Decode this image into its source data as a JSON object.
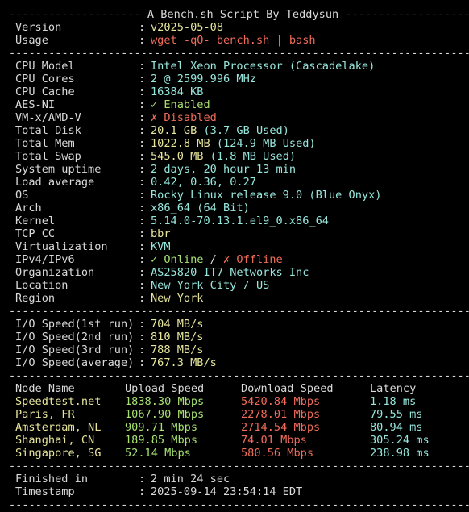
{
  "header_line": "-------------------- A Bench.sh Script By Teddysun -------------------",
  "separator": "----------------------------------------------------------------------",
  "sections": {
    "intro": [
      {
        "label": "Version",
        "value": "v2025-05-08",
        "color": "#e6e59b"
      },
      {
        "label": "Usage",
        "value": "wget -qO- bench.sh | bash",
        "color": "#f06b5a"
      }
    ],
    "system": [
      {
        "label": "CPU Model",
        "parts": [
          {
            "t": "Intel Xeon Processor (Cascadelake)",
            "c": "#96e6dc"
          }
        ]
      },
      {
        "label": "CPU Cores",
        "parts": [
          {
            "t": "2 @ 2599.996 MHz",
            "c": "#96e6dc"
          }
        ]
      },
      {
        "label": "CPU Cache",
        "parts": [
          {
            "t": "16384 KB",
            "c": "#96e6dc"
          }
        ]
      },
      {
        "label": "AES-NI",
        "parts": [
          {
            "t": "✓ Enabled",
            "c": "#a6e070"
          }
        ]
      },
      {
        "label": "VM-x/AMD-V",
        "parts": [
          {
            "t": "✗ Disabled",
            "c": "#f06b5a"
          }
        ]
      },
      {
        "label": "Total Disk",
        "parts": [
          {
            "t": "20.1 GB",
            "c": "#e6e59b"
          },
          {
            "t": " (3.7 GB Used)",
            "c": "#96e6dc"
          }
        ]
      },
      {
        "label": "Total Mem",
        "parts": [
          {
            "t": "1022.8 MB",
            "c": "#e6e59b"
          },
          {
            "t": " (124.9 MB Used)",
            "c": "#96e6dc"
          }
        ]
      },
      {
        "label": "Total Swap",
        "parts": [
          {
            "t": "545.0 MB",
            "c": "#e6e59b"
          },
          {
            "t": " (1.8 MB Used)",
            "c": "#96e6dc"
          }
        ]
      },
      {
        "label": "System uptime",
        "parts": [
          {
            "t": "2 days, 20 hour 13 min",
            "c": "#96e6dc"
          }
        ]
      },
      {
        "label": "Load average",
        "parts": [
          {
            "t": "0.42, 0.36, 0.27",
            "c": "#96e6dc"
          }
        ]
      },
      {
        "label": "OS",
        "parts": [
          {
            "t": "Rocky Linux release 9.0 (Blue Onyx)",
            "c": "#96e6dc"
          }
        ]
      },
      {
        "label": "Arch",
        "parts": [
          {
            "t": "x86_64 (64 Bit)",
            "c": "#96e6dc"
          }
        ]
      },
      {
        "label": "Kernel",
        "parts": [
          {
            "t": "5.14.0-70.13.1.el9_0.x86_64",
            "c": "#96e6dc"
          }
        ]
      },
      {
        "label": "TCP CC",
        "parts": [
          {
            "t": "bbr",
            "c": "#e6e59b"
          }
        ]
      },
      {
        "label": "Virtualization",
        "parts": [
          {
            "t": "KVM",
            "c": "#96e6dc"
          }
        ]
      },
      {
        "label": "IPv4/IPv6",
        "parts": [
          {
            "t": "✓ Online",
            "c": "#a6e070"
          },
          {
            "t": " / ",
            "c": "#d9d9d9"
          },
          {
            "t": "✗ Offline",
            "c": "#f06b5a"
          }
        ]
      },
      {
        "label": "Organization",
        "parts": [
          {
            "t": "AS25820 IT7 Networks Inc",
            "c": "#96e6dc"
          }
        ]
      },
      {
        "label": "Location",
        "parts": [
          {
            "t": "New York City / US",
            "c": "#96e6dc"
          }
        ]
      },
      {
        "label": "Region",
        "parts": [
          {
            "t": "New York",
            "c": "#e6e59b"
          }
        ]
      }
    ],
    "io": [
      {
        "label": "I/O Speed(1st run)",
        "value": "704 MB/s"
      },
      {
        "label": "I/O Speed(2nd run)",
        "value": "810 MB/s"
      },
      {
        "label": "I/O Speed(3rd run)",
        "value": "788 MB/s"
      },
      {
        "label": "I/O Speed(average)",
        "value": "767.3 MB/s"
      }
    ],
    "speed": {
      "headers": [
        "Node Name",
        "Upload Speed",
        "Download Speed",
        "Latency"
      ],
      "rows": [
        [
          "Speedtest.net",
          "1838.30 Mbps",
          "5420.84 Mbps",
          "1.18 ms"
        ],
        [
          "Paris, FR",
          "1067.90 Mbps",
          "2278.01 Mbps",
          "79.55 ms"
        ],
        [
          "Amsterdam, NL",
          "909.71 Mbps",
          "2714.54 Mbps",
          "80.94 ms"
        ],
        [
          "Shanghai, CN",
          "189.85 Mbps",
          "74.01 Mbps",
          "305.24 ms"
        ],
        [
          "Singapore, SG",
          "52.14 Mbps",
          "580.56 Mbps",
          "238.98 ms"
        ]
      ]
    },
    "footer": [
      {
        "label": "Finished in",
        "value": "2 min 24 sec"
      },
      {
        "label": "Timestamp",
        "value": "2025-09-14 23:54:14 EDT"
      }
    ]
  },
  "colors": {
    "default": "#d9d9d9",
    "yellow": "#e6e59b",
    "cyan": "#96e6dc",
    "red": "#f06b5a",
    "green": "#a6e070",
    "background": "#000000"
  }
}
